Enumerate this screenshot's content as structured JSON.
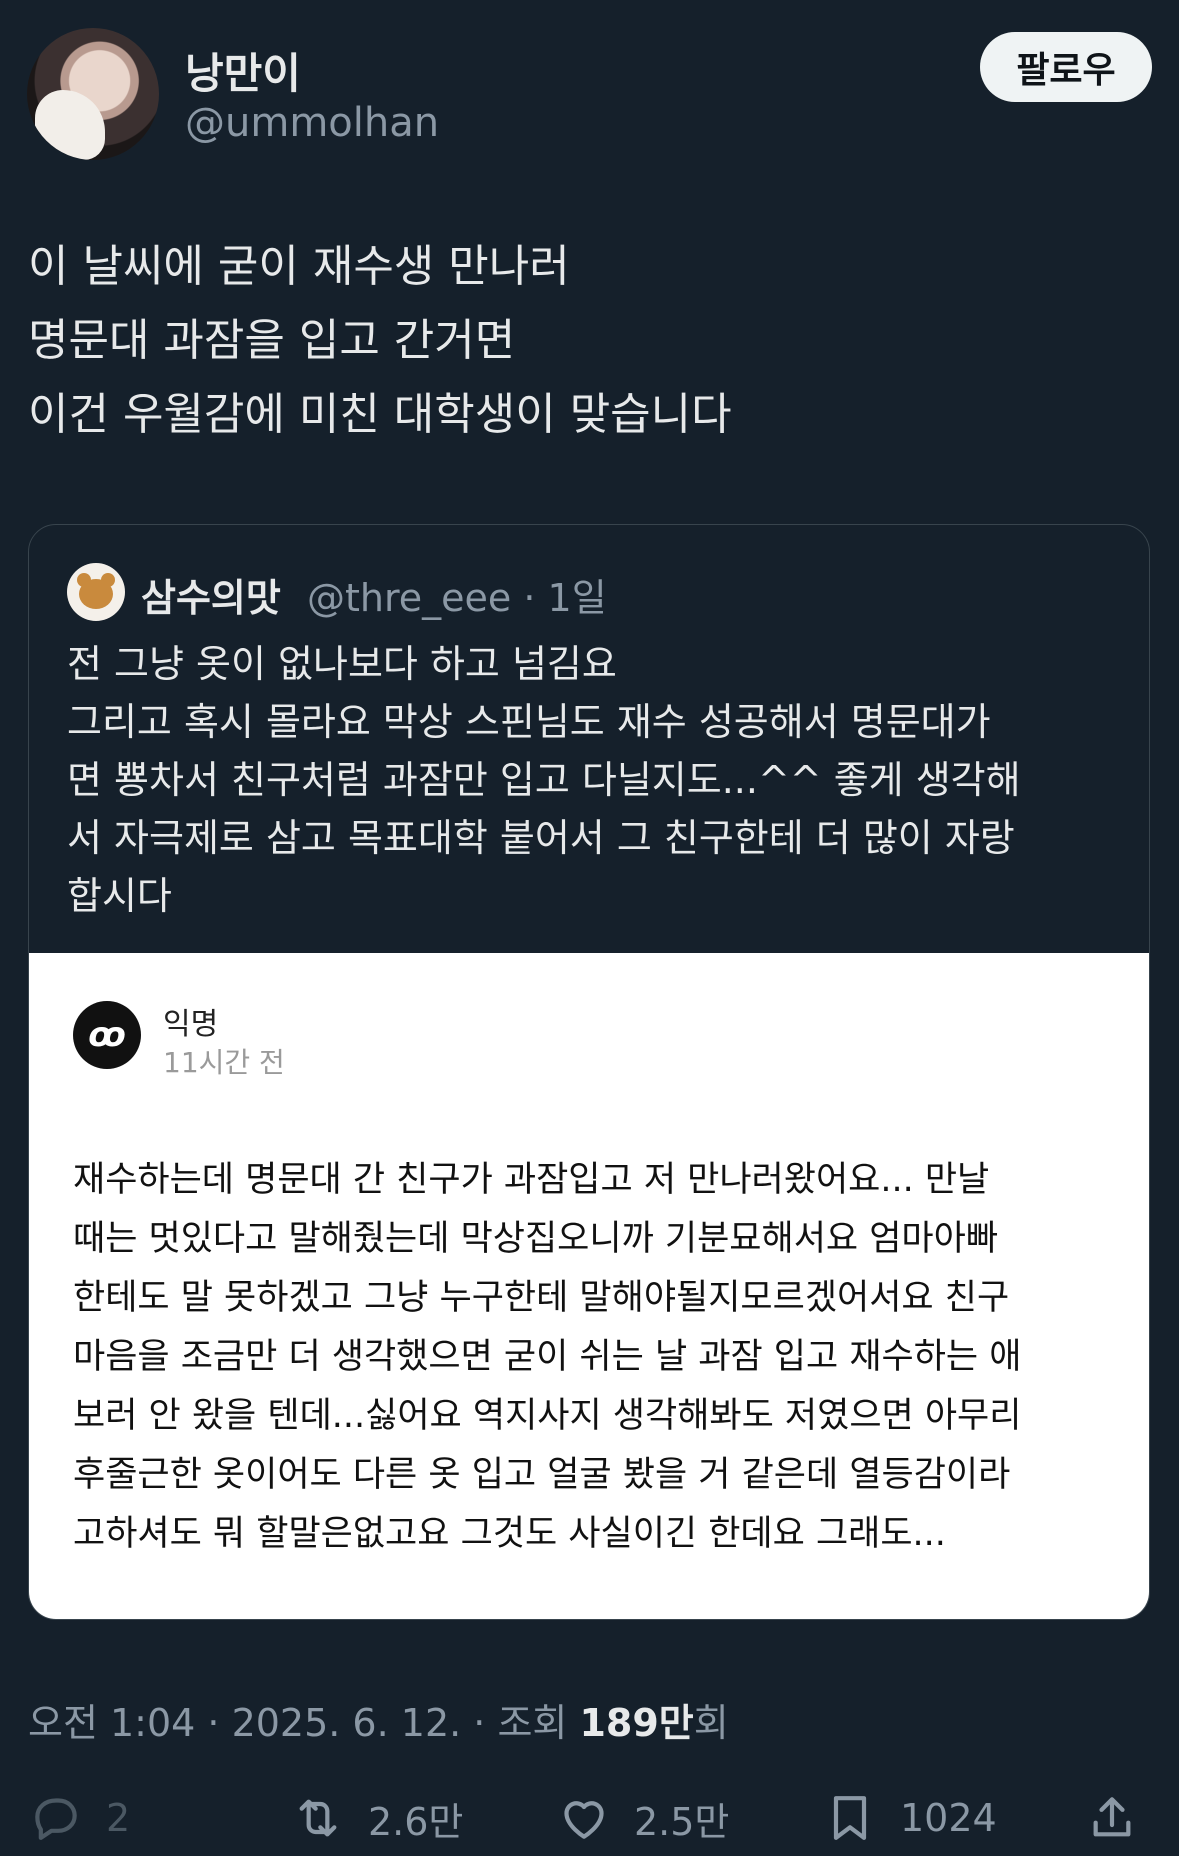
{
  "author": {
    "name": "낭만이",
    "handle": "@ummolhan",
    "follow_label": "팔로우"
  },
  "tweet": {
    "lines": [
      "이 날씨에 굳이 재수생 만나러",
      "명문대 과잠을 입고 간거면",
      "이건 우월감에 미친 대학생이 맞습니다"
    ]
  },
  "quoted": {
    "name": "삼수의맛",
    "meta": "@thre_eee · 1일",
    "lines": [
      "전 그냥 옷이 없나보다 하고 넘김요",
      "그리고 혹시 몰라요 막상 스핀님도 재수 성공해서 명문대가",
      "면 뿅차서 친구처럼 과잠만 입고 다닐지도...^^ 좋게 생각해",
      "서 자극제로 삼고 목표대학 붙어서 그 친구한테 더 많이 자랑",
      "합시다"
    ],
    "attachment": {
      "avatar_glyph": "ꝏ",
      "author": "익명",
      "time": "11시간 전",
      "body": [
        "재수하는데 명문대 간 친구가 과잠입고 저 만나러왔어요... 만날",
        "때는 멋있다고 말해줬는데 막상집오니까 기분묘해서요 엄마아빠",
        "한테도 말 못하겠고 그냥 누구한테 말해야될지모르겠어서요 친구",
        "마음을 조금만 더 생각했으면 굳이 쉬는 날 과잠 입고 재수하는 애",
        "보러 안 왔을 텐데...싫어요 역지사지 생각해봐도 저였으면 아무리",
        "후줄근한 옷이어도 다른 옷 입고 얼굴 봤을 거 같은데 열등감이라",
        "고하셔도 뭐 할말은없고요 그것도 사실이긴 한데요 그래도..."
      ]
    }
  },
  "stats": {
    "time_prefix": "오전 1:04 · 2025. 6. 12. · 조회 ",
    "views": "189만",
    "views_suffix": "회",
    "replies": "2",
    "retweets": "2.6만",
    "likes": "2.5만",
    "bookmarks": "1024"
  },
  "icons": {
    "reply": "reply-icon",
    "retweet": "retweet-icon",
    "like": "heart-icon",
    "bookmark": "bookmark-icon",
    "share": "share-icon"
  }
}
